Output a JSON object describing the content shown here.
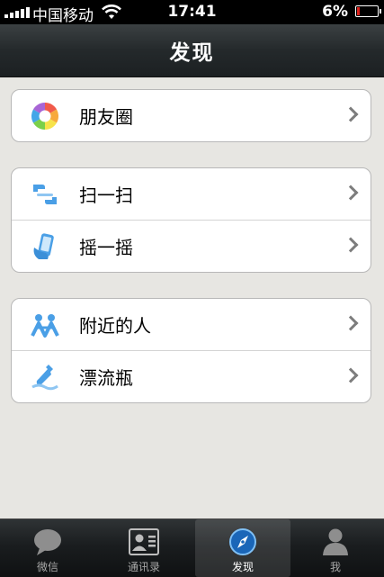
{
  "status_bar": {
    "carrier": "中国移动",
    "time": "17:41",
    "battery_percent": "6%",
    "battery_level": 0.06,
    "battery_color": "#e0211c"
  },
  "nav": {
    "title": "发现"
  },
  "groups": [
    {
      "items": [
        {
          "label": "朋友圈",
          "icon": "moments-aperture-icon"
        }
      ]
    },
    {
      "items": [
        {
          "label": "扫一扫",
          "icon": "scan-icon"
        },
        {
          "label": "摇一摇",
          "icon": "shake-icon"
        }
      ]
    },
    {
      "items": [
        {
          "label": "附近的人",
          "icon": "people-nearby-icon"
        },
        {
          "label": "漂流瓶",
          "icon": "drift-bottle-icon"
        }
      ]
    }
  ],
  "tabs": [
    {
      "label": "微信",
      "icon": "chat-bubble-icon",
      "active": false
    },
    {
      "label": "通讯录",
      "icon": "contacts-card-icon",
      "active": false
    },
    {
      "label": "发现",
      "icon": "compass-icon",
      "active": true
    },
    {
      "label": "我",
      "icon": "person-icon",
      "active": false
    }
  ],
  "colors": {
    "accent_blue": "#4a9fe6",
    "nav_bg": "#24292b",
    "page_bg": "#e7e6e2"
  }
}
